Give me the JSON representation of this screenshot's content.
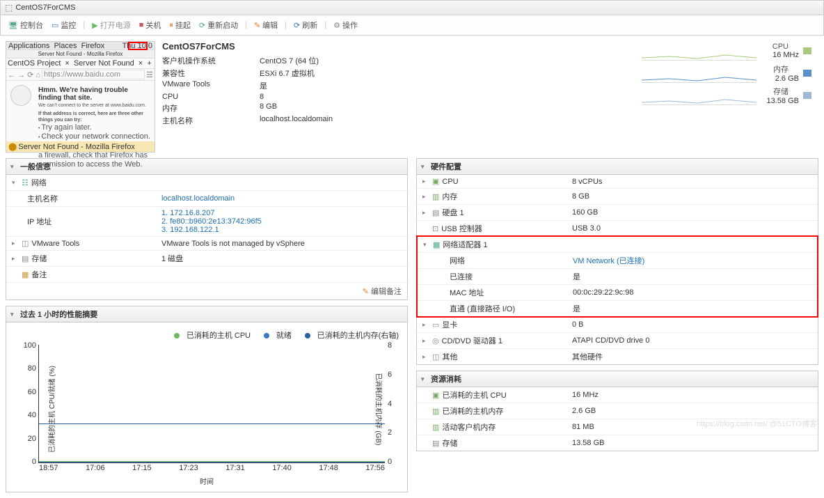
{
  "titlebar": {
    "title": "CentOS7ForCMS"
  },
  "toolbar": {
    "console": "控制台",
    "monitor": "监控",
    "power": "打开电源",
    "shutdown": "关机",
    "suspend": "挂起",
    "restart": "重新启动",
    "edit": "编辑",
    "refresh": "刷新",
    "actions": "操作"
  },
  "thumb": {
    "apps": "Applications",
    "places": "Places",
    "ff": "Firefox",
    "time": "Thu 10:0",
    "wintitle": "Server Not Found - Mozilla Firefox",
    "tab1": "CentOS Project",
    "tab2": "Server Not Found",
    "plus": "+",
    "url": "https://www.baidu.com",
    "h": "Hmm. We're having trouble finding that site.",
    "p1": "We can't connect to the server at www.baidu.com.",
    "p2": "If that address is correct, here are three other things you can try:",
    "b1": "Try again later.",
    "b2": "Check your network connection.",
    "b3": "If you are connected but behind a firewall, check that Firefox has permission to access the Web.",
    "foot": "Server Not Found - Mozilla Firefox"
  },
  "summary": {
    "title": "CentOS7ForCMS",
    "rows": [
      {
        "k": "客户机操作系统",
        "v": "CentOS 7 (64 位)"
      },
      {
        "k": "兼容性",
        "v": "ESXi 6.7 虚拟机"
      },
      {
        "k": "VMware Tools",
        "v": "是"
      },
      {
        "k": "CPU",
        "v": "8"
      },
      {
        "k": "内存",
        "v": "8 GB"
      },
      {
        "k": "主机名称",
        "v": "localhost.localdomain",
        "link": true
      }
    ]
  },
  "minis": [
    {
      "label": "CPU",
      "val": "16 MHz",
      "color": "#a8c97f"
    },
    {
      "label": "内存",
      "val": "2.6 GB",
      "color": "#5b8fc7"
    },
    {
      "label": "存储",
      "val": "13.58 GB",
      "color": "#9fb8d4"
    }
  ],
  "general": {
    "title": "一般信息",
    "net": "网络",
    "host_k": "主机名称",
    "host_v": "localhost.localdomain",
    "ip_k": "IP 地址",
    "ips": [
      "1. 172.16.8.207",
      "2. fe80::b960:2e13:3742:96f5",
      "3. 192.168.122.1"
    ],
    "vmtools_k": "VMware Tools",
    "vmtools_v": "VMware Tools is not managed by vSphere",
    "storage_k": "存储",
    "storage_v": "1 磁盘",
    "notes_k": "备注",
    "edit_notes": "编辑备注"
  },
  "perf": {
    "title": "过去 1 小时的性能摘要",
    "legend": {
      "cpu": "已消耗的主机 CPU",
      "ready": "就绪",
      "mem": "已消耗的主机内存(右轴)"
    },
    "ylab": "已消耗的主机 CPU/就绪 (%)",
    "y2lab": "已消耗的主机内存 (GB)",
    "xlab": "时间"
  },
  "chart_data": {
    "type": "line",
    "x": [
      "18:57",
      "17:06",
      "17:15",
      "17:23",
      "17:31",
      "17:40",
      "17:48",
      "17:56"
    ],
    "ylim": [
      0,
      100
    ],
    "y2lim": [
      0,
      8
    ],
    "series": [
      {
        "name": "已消耗的主机 CPU",
        "axis": "y",
        "color": "#6fb760",
        "values": [
          0.8,
          0.8,
          0.8,
          0.8,
          0.8,
          0.8,
          0.8,
          0.8
        ]
      },
      {
        "name": "就绪",
        "axis": "y",
        "color": "#3a79c7",
        "values": [
          0.3,
          0.3,
          0.3,
          0.3,
          0.3,
          0.3,
          0.3,
          0.3
        ]
      },
      {
        "name": "已消耗的主机内存",
        "axis": "y2",
        "color": "#2a5fa3",
        "values": [
          2.6,
          2.6,
          2.6,
          2.6,
          2.6,
          2.6,
          2.6,
          2.6
        ]
      }
    ],
    "yticks": [
      100,
      80,
      60,
      40,
      20,
      0
    ],
    "y2ticks": [
      8,
      6,
      4,
      2,
      0
    ]
  },
  "hw": {
    "title": "硬件配置",
    "rows": [
      {
        "k": "CPU",
        "v": "8 vCPUs",
        "icon": "cpu",
        "exp": true
      },
      {
        "k": "内存",
        "v": "8 GB",
        "icon": "mem",
        "exp": true
      },
      {
        "k": "硬盘 1",
        "v": "160 GB",
        "icon": "disk",
        "exp": true
      },
      {
        "k": "USB 控制器",
        "v": "USB 3.0",
        "icon": "usb",
        "exp": false
      }
    ],
    "net": {
      "title": "网络适配器 1",
      "rows": [
        {
          "k": "网络",
          "v": "VM Network (已连接)",
          "link": true
        },
        {
          "k": "已连接",
          "v": "是"
        },
        {
          "k": "MAC 地址",
          "v": "00:0c:29:22:9c:98"
        },
        {
          "k": "直通 (直接路径 I/O)",
          "v": "是"
        }
      ]
    },
    "rows2": [
      {
        "k": "显卡",
        "v": "0 B",
        "icon": "vid",
        "exp": true
      },
      {
        "k": "CD/DVD 驱动器 1",
        "v": "ATAPI CD/DVD drive 0",
        "icon": "cd",
        "exp": true
      },
      {
        "k": "其他",
        "v": "其他硬件",
        "icon": "oth",
        "exp": true
      }
    ]
  },
  "res": {
    "title": "资源消耗",
    "rows": [
      {
        "k": "已消耗的主机 CPU",
        "v": "16 MHz",
        "icon": "cpu"
      },
      {
        "k": "已消耗的主机内存",
        "v": "2.6 GB",
        "icon": "mem"
      },
      {
        "k": "活动客户机内存",
        "v": "81 MB",
        "icon": "mem"
      },
      {
        "k": "存储",
        "v": "13.58 GB",
        "icon": "disk"
      }
    ]
  },
  "watermark": "https://blog.csdn.net/ @51CTO博客"
}
